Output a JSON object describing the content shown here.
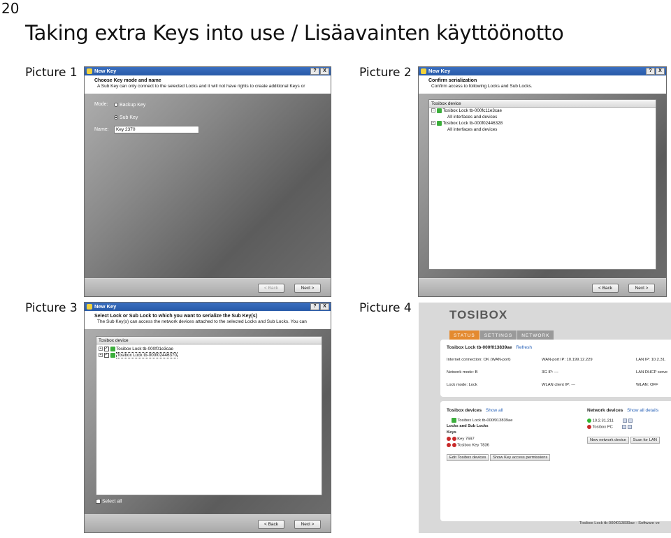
{
  "page_number": "20",
  "title": "Taking extra Keys into use / Lisäavainten käyttöönotto",
  "labels": [
    "Picture 1",
    "Picture 2",
    "Picture 3",
    "Picture 4"
  ],
  "common": {
    "dialog_title": "New Key",
    "help_btn": "?",
    "close_btn": "X",
    "back": "< Back",
    "next": "Next >",
    "tree_header": "Tosibox device"
  },
  "pic1": {
    "heading": "Choose Key mode and name",
    "subheading": "A Sub Key can only connect to the selected Locks and it will not have rights to create additional Keys or",
    "mode_label": "Mode:",
    "opt_backup": "Backup Key",
    "opt_sub": "Sub Key",
    "name_label": "Name:",
    "name_value": "Key 2370"
  },
  "pic2": {
    "heading": "Confirm serialization",
    "subheading": "Confirm access to following Locks and Sub Locks.",
    "tree_header": "Tosibox device",
    "rows": [
      "Tosibox Lock tb-000fc11e3cae",
      "All interfaces and devices",
      "Tosibox Lock tb-000f02446328",
      "All interfaces and devices"
    ]
  },
  "pic3": {
    "heading": "Select Lock or Sub Lock to which you want to serialize the Sub Key(s)",
    "subheading": "The Sub Key(s) can access the network devices attached to the selected Locks and Sub Locks. You can",
    "rows": [
      "Tosibox Lock tb-000f01e3cae",
      "Tosibox Lock tb-000f02446370"
    ],
    "select_all": "Select all"
  },
  "pic4": {
    "brand": "TOSIBOX",
    "tabs": [
      "STATUS",
      "SETTINGS",
      "NETWORK"
    ],
    "lock_title": "Tosibox Lock tb-000f013839ae",
    "refresh": "Refresh",
    "internet": "Internet connection: OK (WAN-port)",
    "wan_ip": "WAN-port IP: 10.199.12.229",
    "lan_ip": "LAN IP: 10.2.31.",
    "network_mode": "Network mode: B",
    "ip3g": "3G IP: ---",
    "lan_dhcp": "LAN DHCP serve",
    "lock_mode": "Lock mode: Lock",
    "wlan_ip": "WLAN client IP: ---",
    "wlan": "WLAN: OFF",
    "devices_title": "Tosibox devices",
    "show_all": "Show all",
    "device_lock": "Tosibox Lock tb-000f013839ae",
    "locks_sub": "Locks and Sub Locks",
    "keys": "Keys",
    "key1": "Key 7697",
    "key2": "Tosibox Key 7836",
    "edit_btn": "Edit Tosibox devices",
    "show_key_btn": "Show Key access permissions",
    "net_title": "Network devices",
    "show_all_details": "Show all details",
    "net1": "10.2.31.211",
    "net2": "Tosibox PC",
    "new_device": "New network device",
    "scan": "Scan for LAN",
    "footer": "Tosibox Lock tb-000f013839ae - Software ve"
  }
}
